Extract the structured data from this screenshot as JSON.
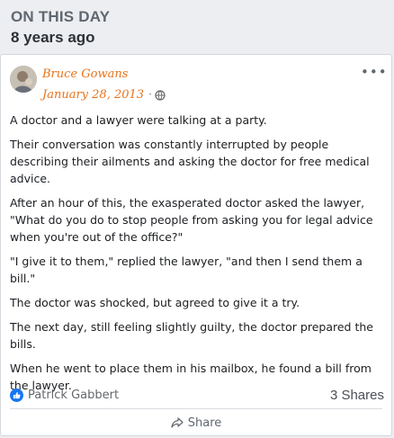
{
  "memory": {
    "title": "ON THIS DAY",
    "subtitle": "8 years ago"
  },
  "post": {
    "author": "Bruce Gowans",
    "date": "January 28, 2013",
    "separator": "·",
    "privacy_icon": "globe-icon",
    "more_icon": "more-options-icon",
    "paragraphs": [
      "A doctor and a lawyer were talking at a party.",
      "Their conversation was constantly interrupted by people describing their ailments and asking the doctor for free medical advice.",
      "After an hour of this, the exasperated doctor asked the lawyer, \"What do you do to stop people from asking you for legal advice when you're out of the office?\"",
      "\"I give it to them,\" replied the lawyer, \"and then I send them a bill.\"",
      "The doctor was shocked, but agreed to give it a try.",
      "The next day, still feeling slightly guilty, the doctor prepared the bills.",
      "When he went to place them in his mailbox, he found a bill from the lawyer."
    ]
  },
  "footer": {
    "reactor": "Patrick Gabbert",
    "reaction_icon": "like-icon",
    "shares": "3 Shares",
    "share_label": "Share",
    "share_icon": "share-arrow-icon"
  },
  "colors": {
    "author": "#e8731a",
    "like": "#1877f2",
    "background": "#eceef1"
  }
}
